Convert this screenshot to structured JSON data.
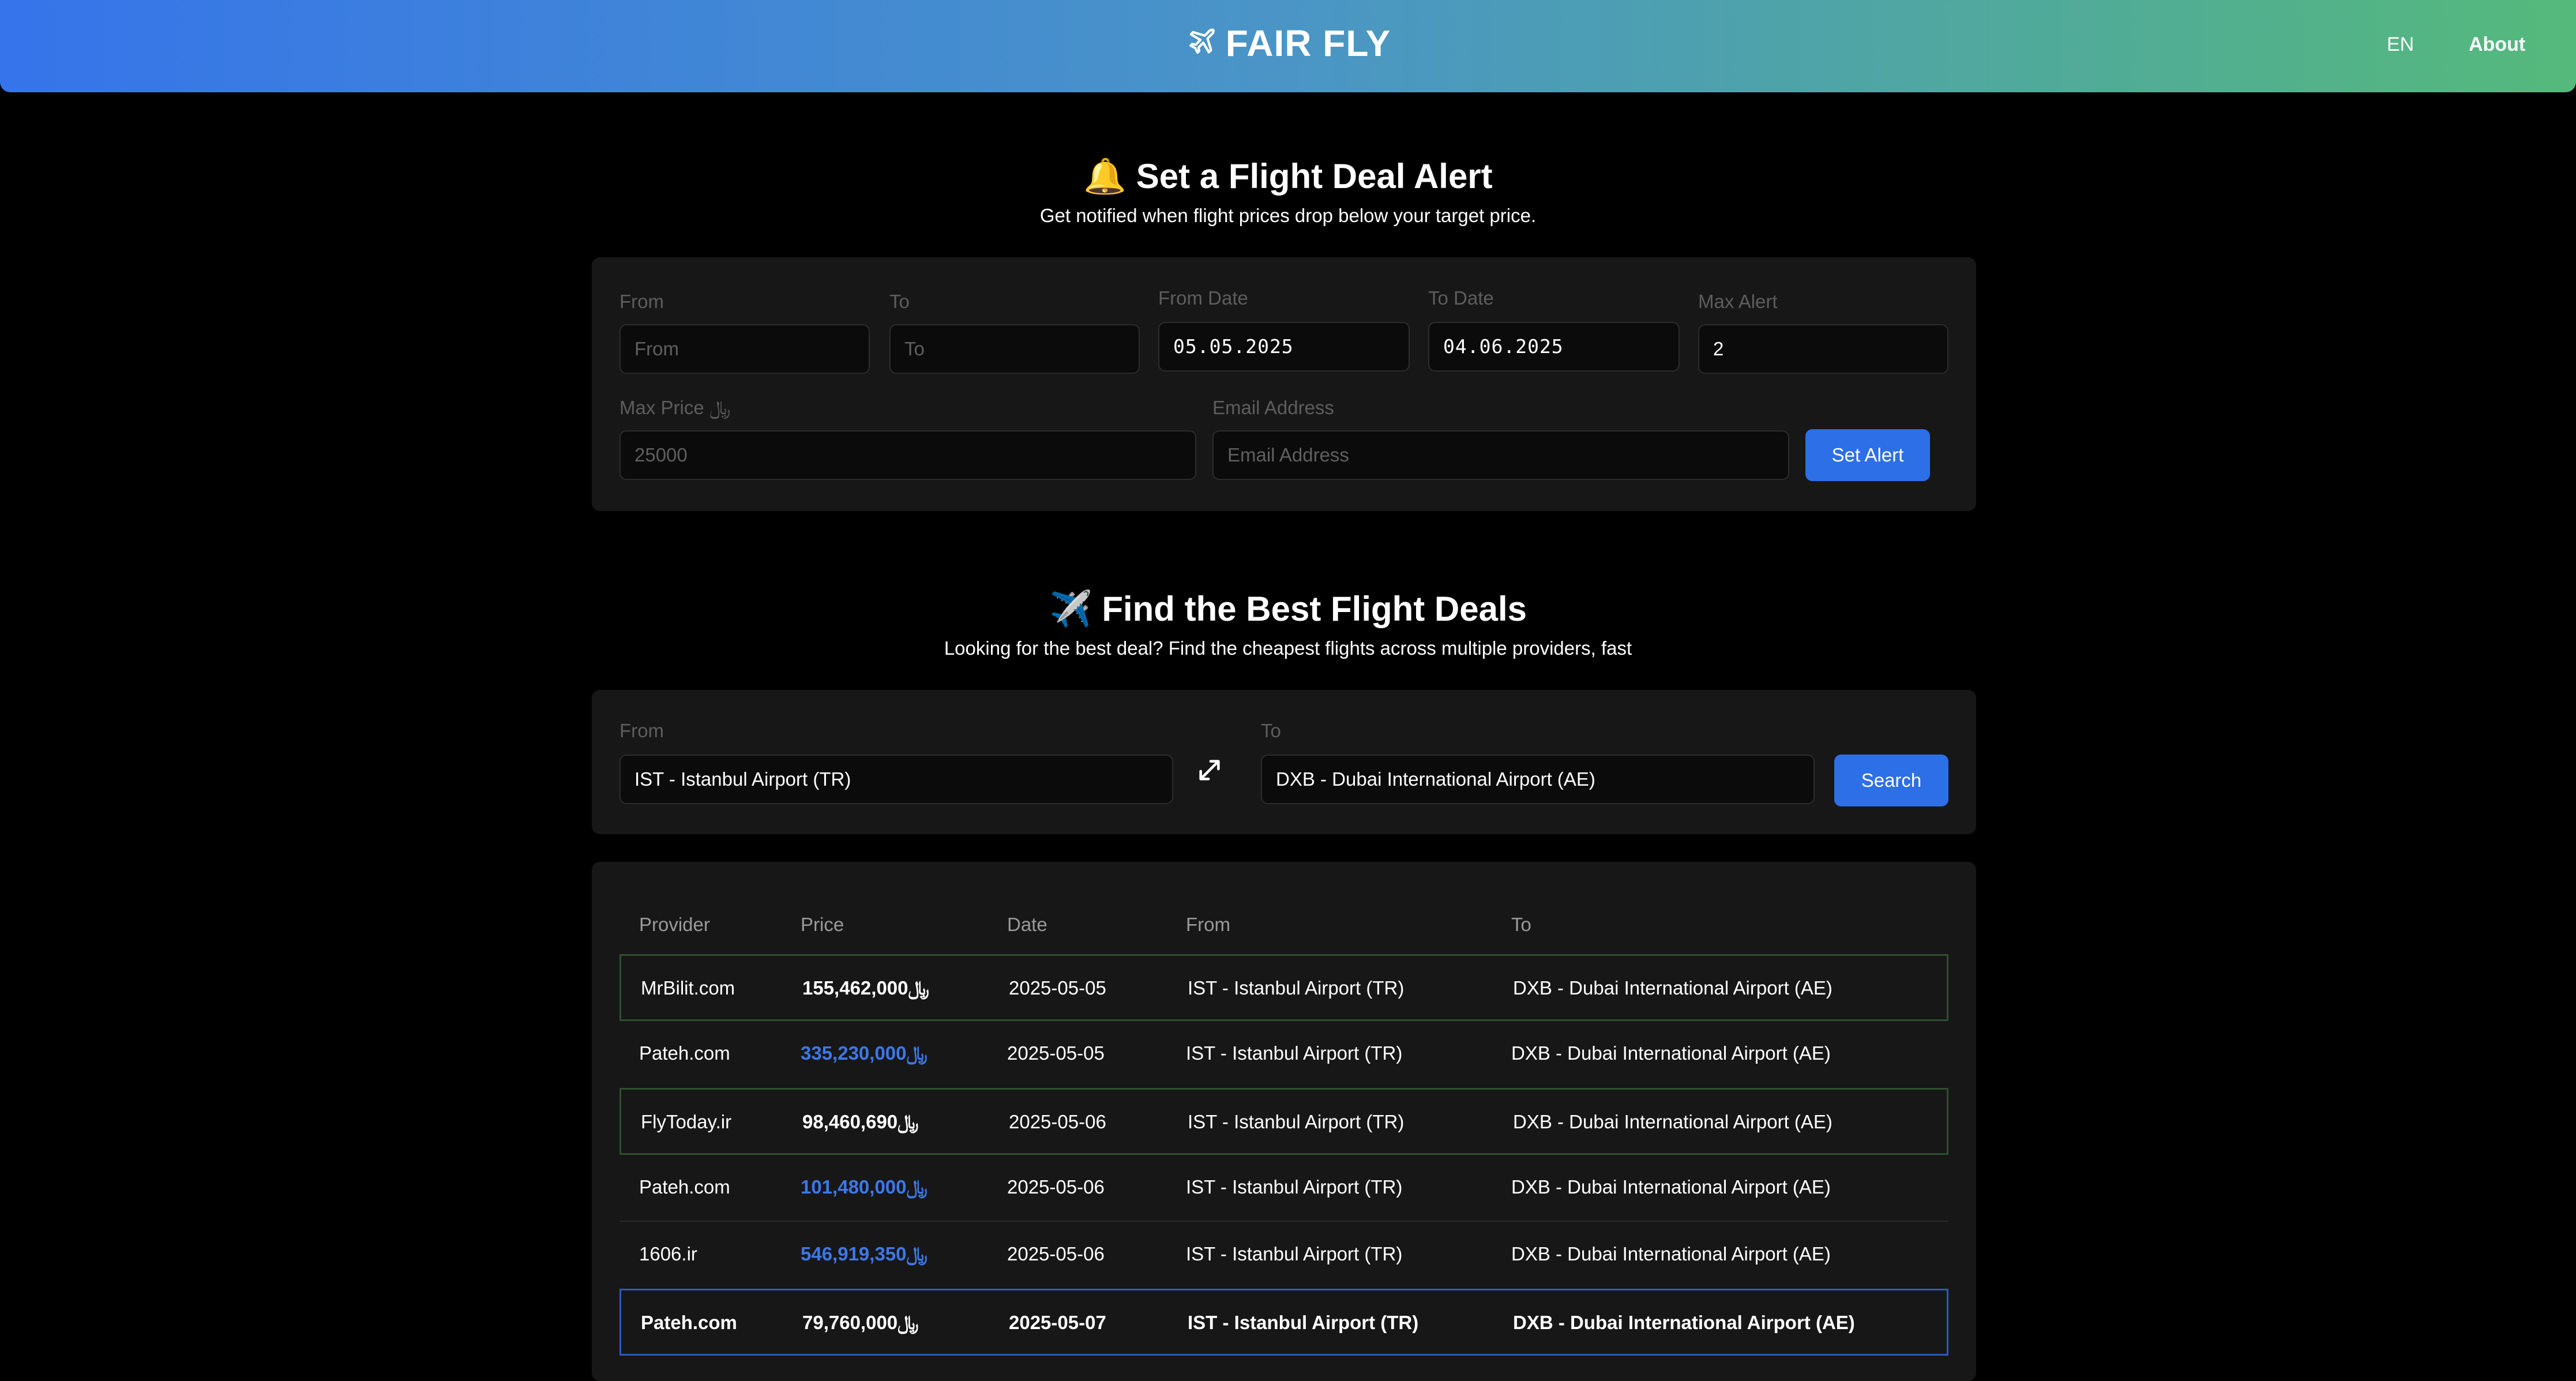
{
  "header": {
    "brand": "FAIR FLY",
    "lang": "EN",
    "about": "About"
  },
  "alert": {
    "icon": "bell-icon",
    "title": "🔔 Set a Flight Deal Alert",
    "subtitle": "Get notified when flight prices drop below your target price.",
    "from_label": "From",
    "from_placeholder": "From",
    "to_label": "To",
    "to_placeholder": "To",
    "from_date_label": "From Date",
    "from_date_value": "05.05.2025",
    "to_date_label": "To Date",
    "to_date_value": "04.06.2025",
    "max_alert_label": "Max Alert",
    "max_alert_value": "2",
    "max_price_label": "Max Price ﷼",
    "max_price_placeholder": "25000",
    "email_label": "Email Address",
    "email_placeholder": "Email Address",
    "set_alert_button": "Set Alert"
  },
  "search": {
    "title": "✈️ Find the Best Flight Deals",
    "subtitle": "Looking for the best deal? Find the cheapest flights across multiple providers, fast",
    "from_label": "From",
    "from_value": "IST - Istanbul Airport (TR)",
    "to_label": "To",
    "to_value": "DXB - Dubai International Airport (AE)",
    "search_button": "Search",
    "swap_icon": "swap-arrows-icon"
  },
  "results": {
    "headers": [
      "Provider",
      "Price",
      "Date",
      "From",
      "To"
    ],
    "rows": [
      {
        "provider": "MrBilit.com",
        "price": "155,462,000﷼",
        "date": "2025-05-05",
        "from": "IST - Istanbul Airport (TR)",
        "to": "DXB - Dubai International Airport (AE)",
        "style": "green",
        "price_color": "white"
      },
      {
        "provider": "Pateh.com",
        "price": "335,230,000﷼",
        "date": "2025-05-05",
        "from": "IST - Istanbul Airport (TR)",
        "to": "DXB - Dubai International Airport (AE)",
        "style": "plain",
        "price_color": "blue"
      },
      {
        "provider": "FlyToday.ir",
        "price": "98,460,690﷼",
        "date": "2025-05-06",
        "from": "IST - Istanbul Airport (TR)",
        "to": "DXB - Dubai International Airport (AE)",
        "style": "green",
        "price_color": "white"
      },
      {
        "provider": "Pateh.com",
        "price": "101,480,000﷼",
        "date": "2025-05-06",
        "from": "IST - Istanbul Airport (TR)",
        "to": "DXB - Dubai International Airport (AE)",
        "style": "line",
        "price_color": "blue"
      },
      {
        "provider": "1606.ir",
        "price": "546,919,350﷼",
        "date": "2025-05-06",
        "from": "IST - Istanbul Airport (TR)",
        "to": "DXB - Dubai International Airport (AE)",
        "style": "plain",
        "price_color": "blue"
      },
      {
        "provider": "Pateh.com",
        "price": "79,760,000﷼",
        "date": "2025-05-07",
        "from": "IST - Istanbul Airport (TR)",
        "to": "DXB - Dubai International Airport (AE)",
        "style": "blue",
        "price_color": "white"
      }
    ]
  },
  "colors": {
    "accent": "#2d6fe6",
    "gradient_start": "#3574ea",
    "gradient_end": "#55b97b",
    "highlight_green": "#2f4f2e",
    "highlight_blue": "#2b5bb8",
    "price_blue": "#3c78e8"
  }
}
